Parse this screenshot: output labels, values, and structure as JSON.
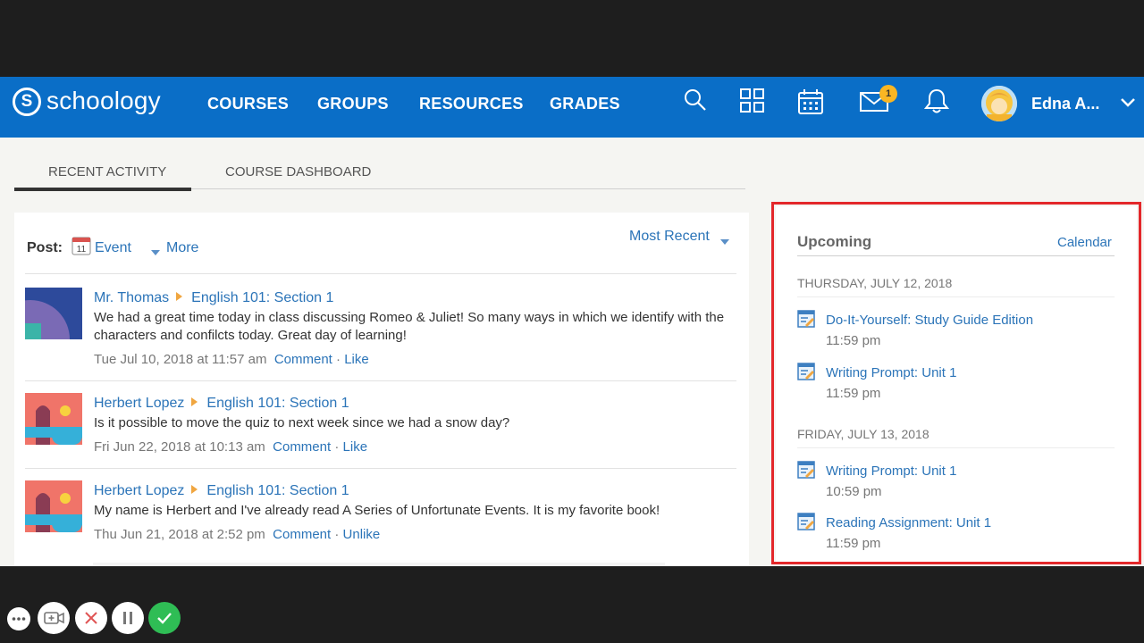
{
  "brand": {
    "name": "schoology",
    "mark": "S"
  },
  "nav": {
    "items": [
      "COURSES",
      "GROUPS",
      "RESOURCES",
      "GRADES"
    ],
    "icons": [
      "search-icon",
      "grid-icon",
      "calendar-icon",
      "mail-icon",
      "bell-icon"
    ],
    "mail_badge": "1",
    "user_name": "Edna A..."
  },
  "tabs": [
    "RECENT ACTIVITY",
    "COURSE DASHBOARD"
  ],
  "composer": {
    "post_label": "Post:",
    "calendar_day": "11",
    "event_label": "Event",
    "more_label": "More",
    "sort_label": "Most Recent"
  },
  "feed": [
    {
      "author": "Mr. Thomas",
      "course": "English 101: Section 1",
      "text": "We had a great time today in class discussing Romeo & Juliet! So many ways in which we identify with the characters and confilcts today. Great day of learning!",
      "time": "Tue Jul 10, 2018 at 11:57 am",
      "comment": "Comment",
      "like": "Like"
    },
    {
      "author": "Herbert Lopez",
      "course": "English 101: Section 1",
      "text": "Is it possible to move the quiz to next week since we had a snow day?",
      "time": "Fri Jun 22, 2018 at 10:13 am",
      "comment": "Comment",
      "like": "Like"
    },
    {
      "author": "Herbert Lopez",
      "course": "English 101: Section 1",
      "text": "My name is Herbert and I've already read A Series of Unfortunate Events. It is my favorite book!",
      "time": "Thu Jun 21, 2018 at 2:52 pm",
      "comment": "Comment",
      "like": "Unlike"
    }
  ],
  "upcoming": {
    "title": "Upcoming",
    "calendar_link": "Calendar",
    "days": [
      {
        "date": "THURSDAY, JULY 12, 2018",
        "items": [
          {
            "name": "Do-It-Yourself: Study Guide Edition",
            "time": "11:59 pm"
          },
          {
            "name": "Writing Prompt: Unit 1",
            "time": "11:59 pm"
          }
        ]
      },
      {
        "date": "FRIDAY, JULY 13, 2018",
        "items": [
          {
            "name": "Writing Prompt: Unit 1",
            "time": "10:59 pm"
          },
          {
            "name": "Reading Assignment: Unit 1",
            "time": "11:59 pm"
          }
        ]
      }
    ]
  },
  "recorder_controls": [
    "more-icon",
    "webcam-icon",
    "cancel-icon",
    "pause-icon",
    "done-icon"
  ],
  "colors": {
    "nav_bg": "#0a6ec7",
    "link": "#2b74b8",
    "badge": "#f9b623",
    "highlight_border": "#e3272a",
    "done_button": "#2fbd55"
  }
}
